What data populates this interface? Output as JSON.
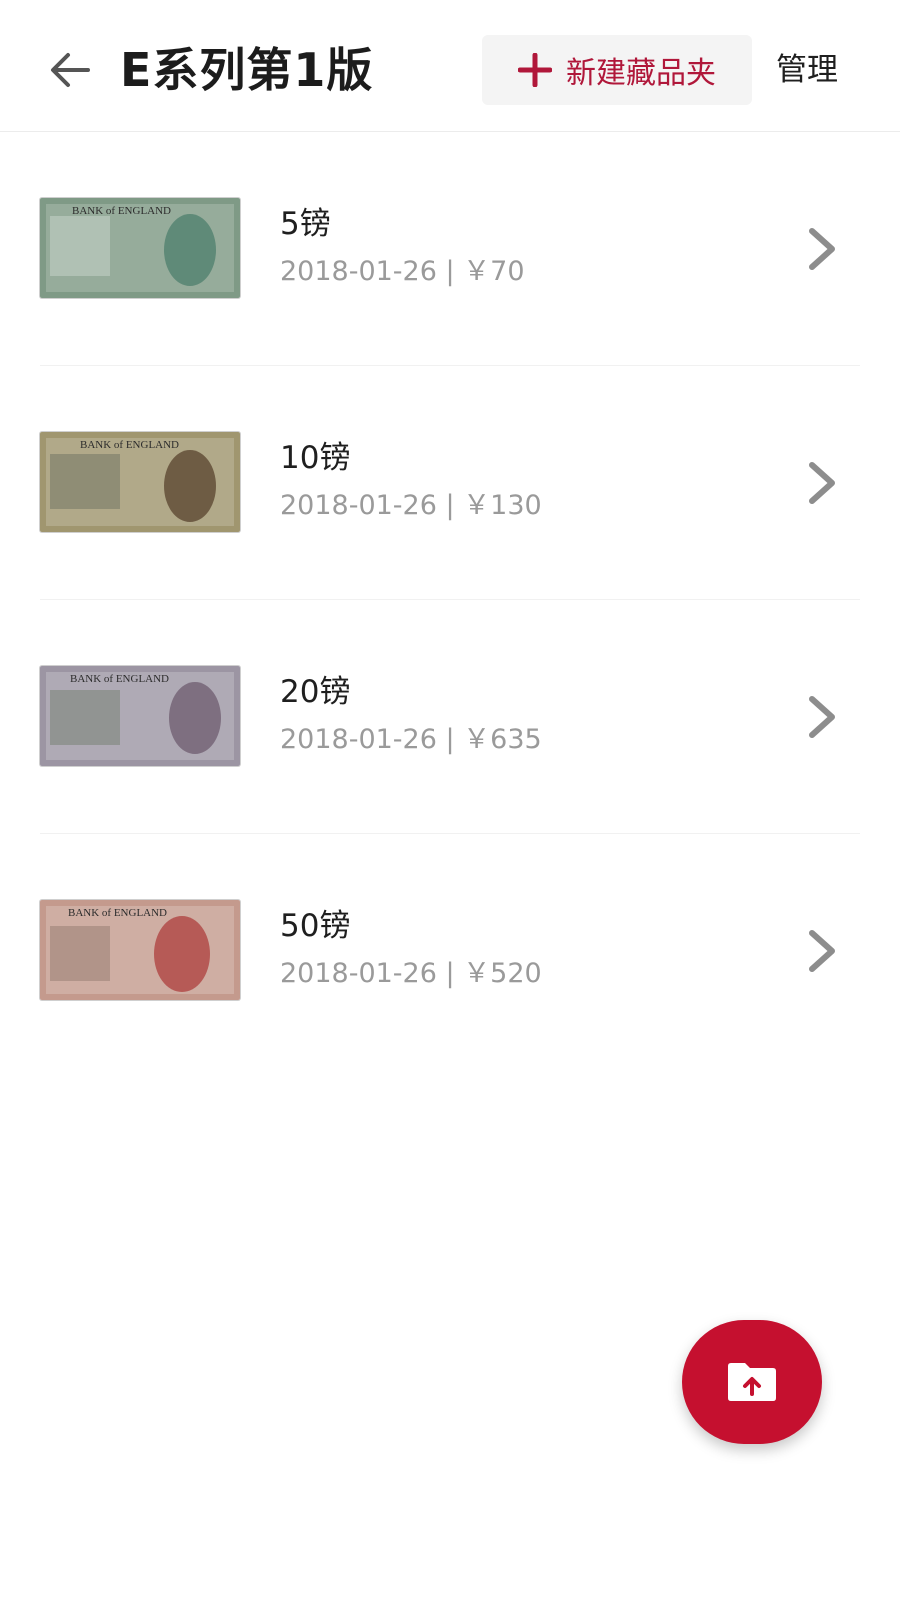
{
  "header": {
    "title": "E系列第1版",
    "new_folder_label": "新建藏品夹",
    "manage_label": "管理"
  },
  "colors": {
    "accent": "#c5102f",
    "accent_text": "#b0173a",
    "meta_text": "#9a9a9a"
  },
  "icons": {
    "back": "arrow-left-icon",
    "add": "plus-icon",
    "item_action": "chevron-right-icon",
    "fab": "folder-upload-icon"
  },
  "items": [
    {
      "name": "5镑",
      "meta": "2018-01-26 | ￥70",
      "note_color": "#7f9a86",
      "portrait_color": "#5f8a78"
    },
    {
      "name": "10镑",
      "meta": "2018-01-26 | ￥130",
      "note_color": "#a0966f",
      "portrait_color": "#6e5c44"
    },
    {
      "name": "20镑",
      "meta": "2018-01-26 | ￥635",
      "note_color": "#9c95a3",
      "portrait_color": "#7e6f80"
    },
    {
      "name": "50镑",
      "meta": "2018-01-26 | ￥520",
      "note_color": "#c49a8d",
      "portrait_color": "#b65a56"
    }
  ]
}
